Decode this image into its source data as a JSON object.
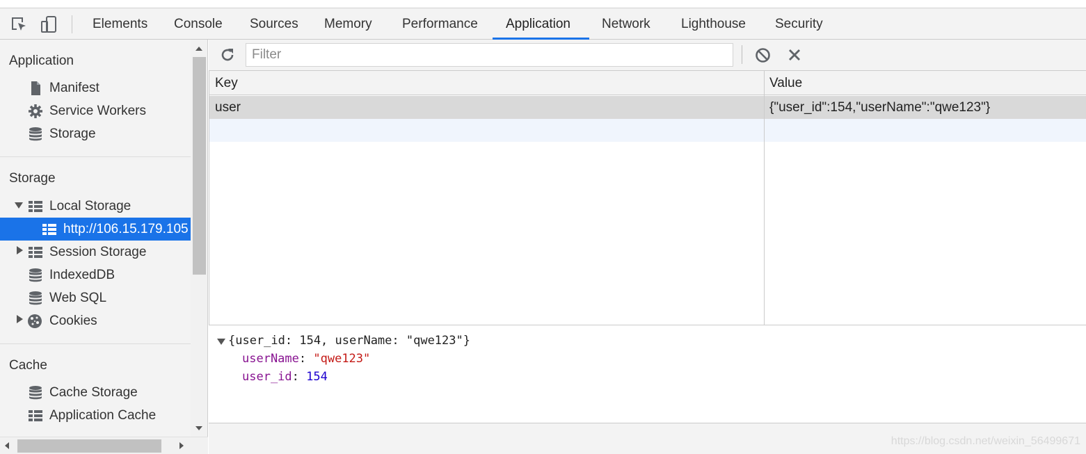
{
  "toolbar_icons": [
    "inspect-element-icon",
    "device-toolbar-icon"
  ],
  "tabs": [
    {
      "label": "Elements"
    },
    {
      "label": "Console"
    },
    {
      "label": "Sources"
    },
    {
      "label": "Memory"
    },
    {
      "label": "Performance"
    },
    {
      "label": "Application",
      "active": true
    },
    {
      "label": "Network"
    },
    {
      "label": "Lighthouse"
    },
    {
      "label": "Security"
    }
  ],
  "sidebar": {
    "application": {
      "title": "Application",
      "items": [
        {
          "label": "Manifest",
          "icon": "document-icon"
        },
        {
          "label": "Service Workers",
          "icon": "gear-icon"
        },
        {
          "label": "Storage",
          "icon": "database-icon"
        }
      ]
    },
    "storage": {
      "title": "Storage",
      "local_storage": {
        "label": "Local Storage",
        "icon": "table-icon",
        "expanded": true
      },
      "origin": {
        "label": "http://106.15.179.105",
        "icon": "table-icon",
        "selected": true
      },
      "session_storage": {
        "label": "Session Storage",
        "icon": "table-icon"
      },
      "indexeddb": {
        "label": "IndexedDB",
        "icon": "database-icon"
      },
      "websql": {
        "label": "Web SQL",
        "icon": "database-icon"
      },
      "cookies": {
        "label": "Cookies",
        "icon": "cookie-icon"
      }
    },
    "cache": {
      "title": "Cache",
      "items": [
        {
          "label": "Cache Storage",
          "icon": "database-icon"
        },
        {
          "label": "Application Cache",
          "icon": "table-icon"
        }
      ]
    }
  },
  "main": {
    "filter_placeholder": "Filter",
    "table": {
      "headers": {
        "key": "Key",
        "value": "Value"
      },
      "rows": [
        {
          "key": "user",
          "value": "{\"user_id\":154,\"userName\":\"qwe123\"}"
        }
      ]
    },
    "preview": {
      "summary": "{user_id: 154, userName: \"qwe123\"}",
      "props": [
        {
          "key": "userName",
          "sep": ": ",
          "value": "\"qwe123\"",
          "kind": "string"
        },
        {
          "key": "user_id",
          "sep": ": ",
          "value": "154",
          "kind": "number"
        }
      ]
    }
  },
  "watermark": "https://blog.csdn.net/weixin_56499671",
  "colors": {
    "accent": "#1a73e8",
    "selected_row": "#d9d9d9",
    "panel_bg": "#f3f3f3"
  }
}
